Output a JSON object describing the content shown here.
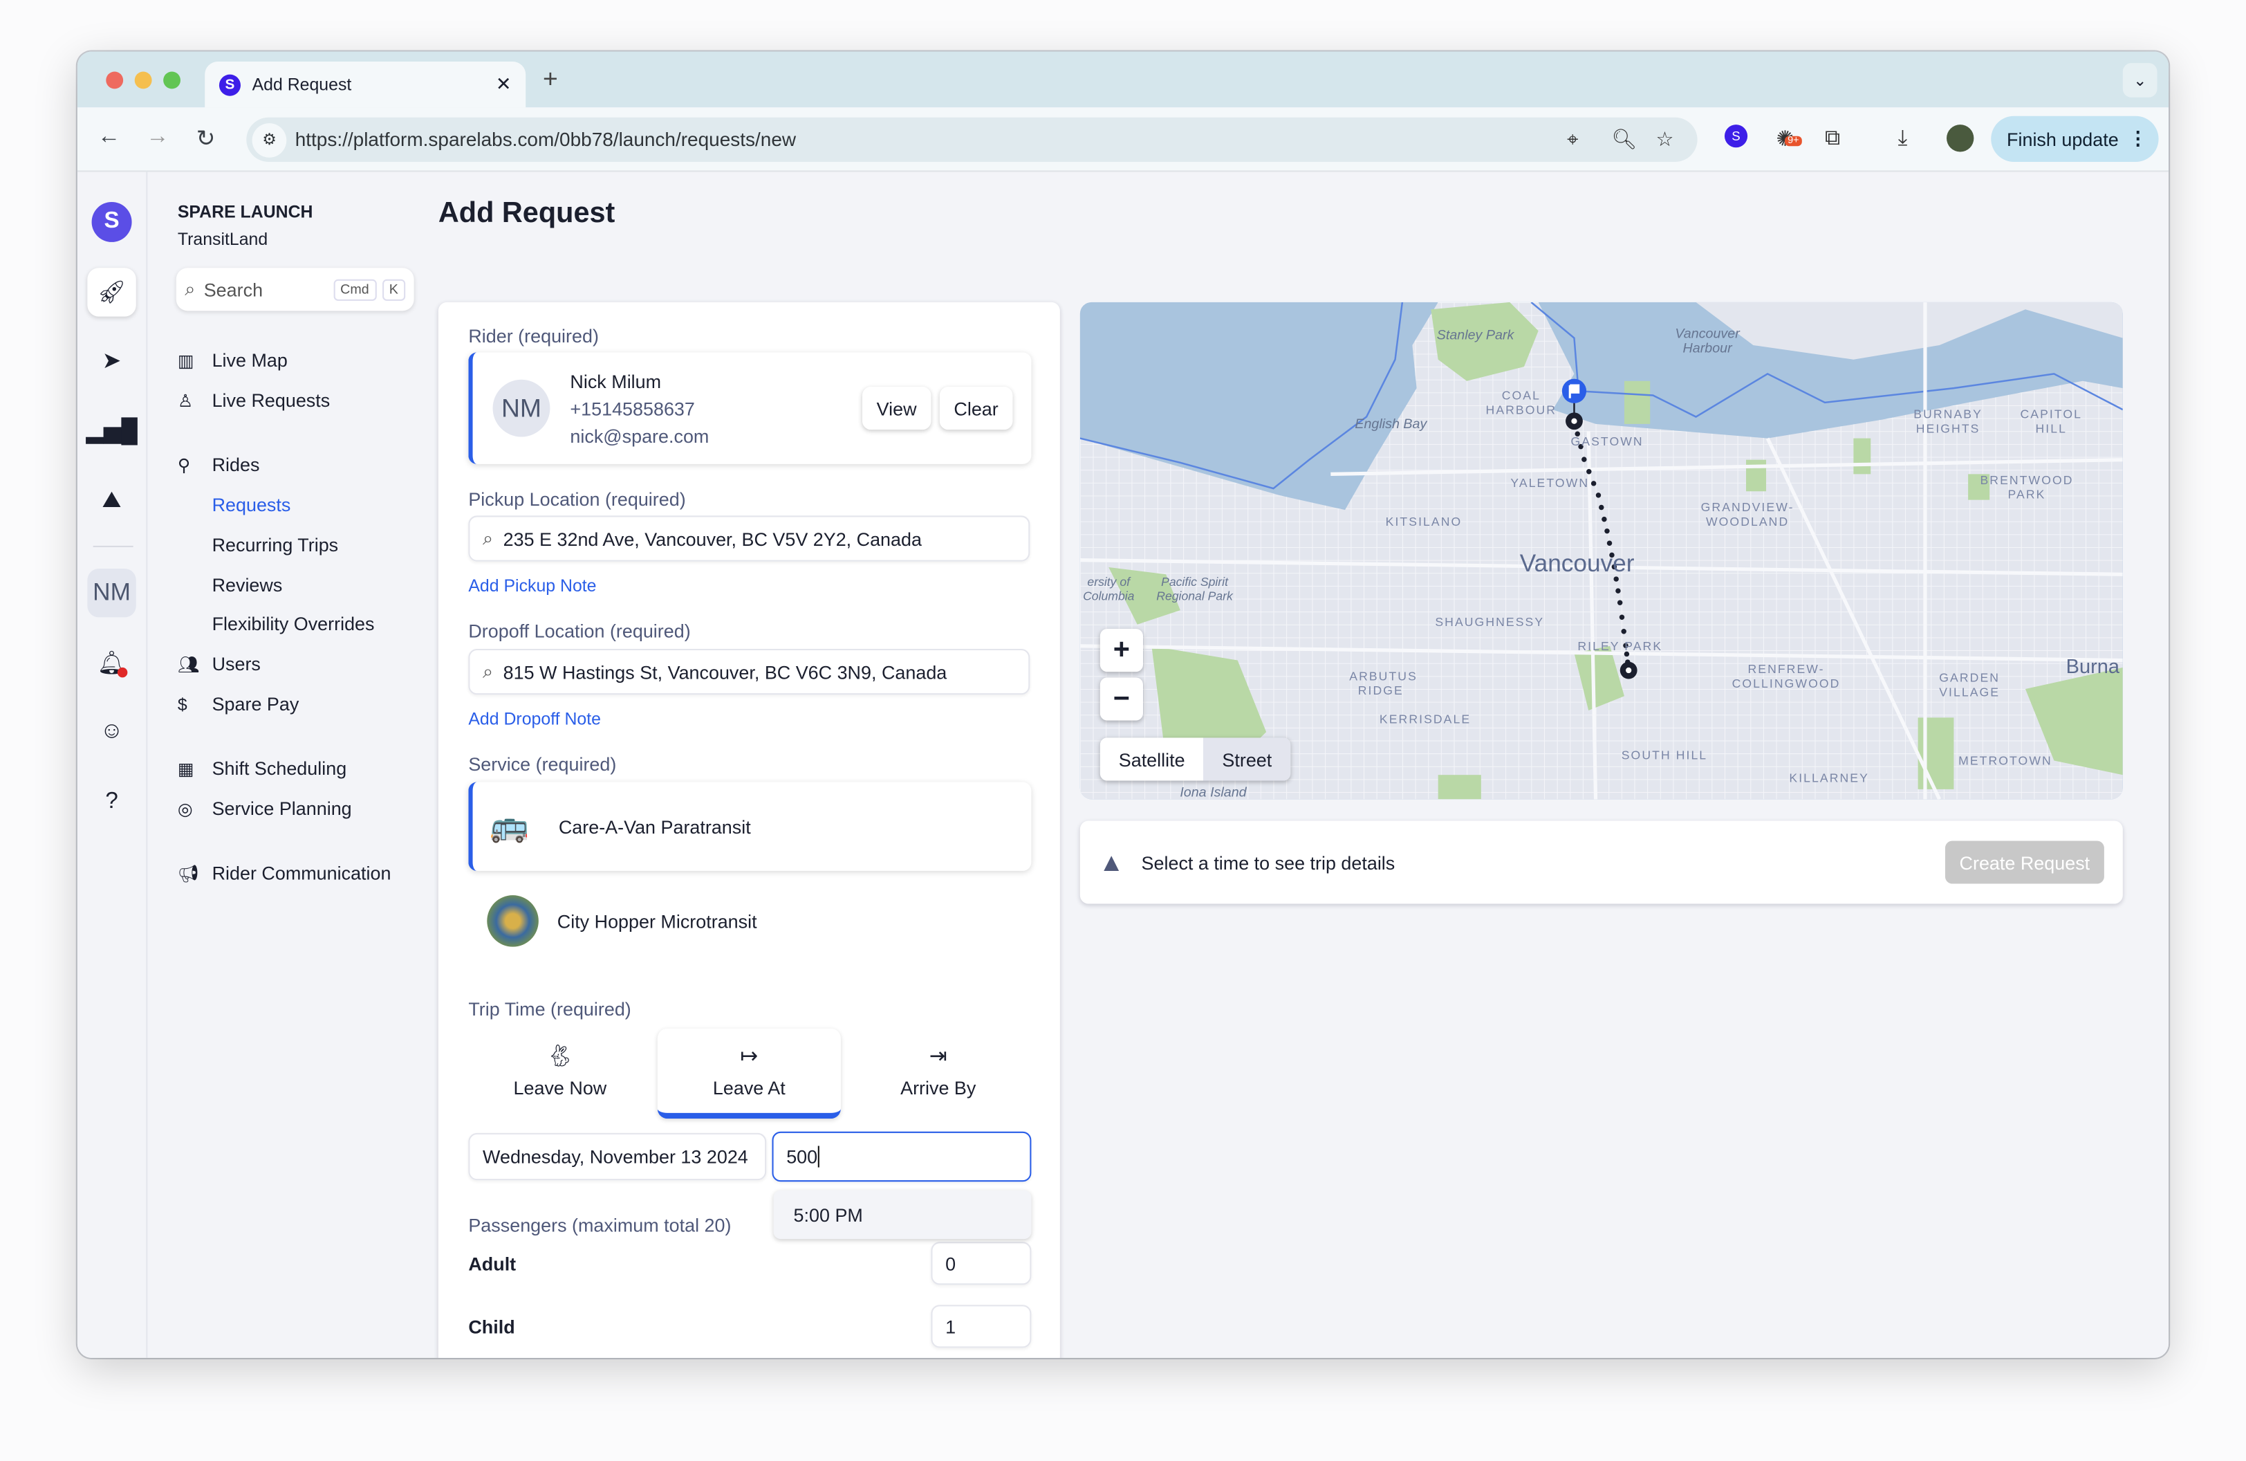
{
  "browser": {
    "tab_title": "Add Request",
    "favicon_letter": "S",
    "url": "https://platform.sparelabs.com/0bb78/launch/requests/new",
    "extension_badge": "9+",
    "finish_update_label": "Finish update"
  },
  "rail": {
    "logo_letter": "S",
    "user_initials": "NM"
  },
  "sidebar": {
    "org_name": "SPARE LAUNCH",
    "org_sub": "TransitLand",
    "search_placeholder": "Search",
    "kbd_cmd": "Cmd",
    "kbd_k": "K",
    "items": [
      {
        "label": "Live Map"
      },
      {
        "label": "Live Requests"
      },
      {
        "label": "Rides"
      },
      {
        "label": "Requests"
      },
      {
        "label": "Recurring Trips"
      },
      {
        "label": "Reviews"
      },
      {
        "label": "Flexibility Overrides"
      },
      {
        "label": "Users"
      },
      {
        "label": "Spare Pay"
      },
      {
        "label": "Shift Scheduling"
      },
      {
        "label": "Service Planning"
      },
      {
        "label": "Rider Communication"
      }
    ],
    "active_item": "Requests"
  },
  "page": {
    "title": "Add Request"
  },
  "form": {
    "rider_label": "Rider (required)",
    "rider": {
      "initials": "NM",
      "name": "Nick Milum",
      "phone": "+15145858637",
      "email": "nick@spare.com",
      "view_label": "View",
      "clear_label": "Clear"
    },
    "pickup_label": "Pickup Location (required)",
    "pickup_value": "235 E 32nd Ave, Vancouver, BC V5V 2Y2, Canada",
    "pickup_note": "Add Pickup Note",
    "dropoff_label": "Dropoff Location (required)",
    "dropoff_value": "815 W Hastings St, Vancouver, BC V6C 3N9, Canada",
    "dropoff_note": "Add Dropoff Note",
    "service_label": "Service (required)",
    "services": [
      {
        "name": "Care-A-Van Paratransit",
        "selected": true
      },
      {
        "name": "City Hopper Microtransit",
        "selected": false
      }
    ],
    "trip_time_label": "Trip Time (required)",
    "trip_modes": [
      {
        "label": "Leave Now",
        "icon": "rabbit-icon"
      },
      {
        "label": "Leave At",
        "icon": "arrow-from-bar-icon"
      },
      {
        "label": "Arrive By",
        "icon": "arrow-to-bar-icon"
      }
    ],
    "selected_mode": "Leave At",
    "date_value": "Wednesday, November 13 2024",
    "time_value": "500",
    "time_suggestion": "5:00 PM",
    "passengers_label": "Passengers (maximum total 20)",
    "passengers": [
      {
        "label": "Adult",
        "value": "0"
      },
      {
        "label": "Child",
        "value": "1"
      }
    ]
  },
  "map": {
    "labels": {
      "stanley": "Stanley Park",
      "harbour": "Vancouver Harbour",
      "english_bay": "English Bay",
      "coal": "COAL HARBOUR",
      "gastown": "GASTOWN",
      "yaletown": "YALETOWN",
      "kits": "KITSILANO",
      "grandview": "GRANDVIEW-WOODLAND",
      "burnaby_h": "BURNABY HEIGHTS",
      "capitol": "CAPITOL HILL",
      "brentwood": "BRENTWOOD PARK",
      "city": "Vancouver",
      "pacific": "Pacific Spirit Regional Park",
      "ubc": "ersity of Columbia",
      "shaughnessy": "SHAUGHNESSY",
      "riley": "RILEY PARK",
      "arbutus": "ARBUTUS RIDGE",
      "kerrisdale": "KERRISDALE",
      "renfrew": "RENFREW-COLLINGWOOD",
      "garden": "GARDEN VILLAGE",
      "burnaby": "Burna",
      "south_hill": "SOUTH HILL",
      "metrotown": "METROTOWN",
      "killarney": "KILLARNEY",
      "iona": "Iona Island"
    },
    "zoom_in": "+",
    "zoom_out": "−",
    "satellite_label": "Satellite",
    "street_label": "Street",
    "colors": {
      "water": "#a9c4de",
      "land": "#e3e6ee",
      "park": "#b9d8a6",
      "route": "#1b1f2e",
      "flag": "#2a5ee8"
    }
  },
  "trip_details": {
    "message": "Select a time to see trip details",
    "create_label": "Create Request"
  }
}
